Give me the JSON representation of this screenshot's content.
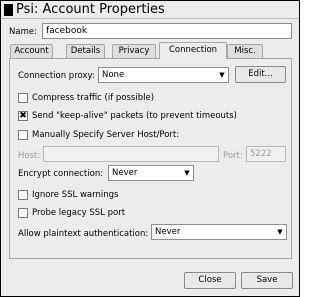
{
  "window": {
    "title": "Psi: Account Properties"
  },
  "name_field": {
    "label": "Name:",
    "value": "facebook"
  },
  "tabs": [
    {
      "label": "Account"
    },
    {
      "label": "Details"
    },
    {
      "label": "Privacy"
    },
    {
      "label": "Connection"
    },
    {
      "label": "Misc."
    }
  ],
  "active_tab": "Connection",
  "connection": {
    "proxy_label": "Connection proxy:",
    "proxy_value": "None",
    "edit_button": "Edit...",
    "compress_label": "Compress traffic (if possible)",
    "compress_checked": false,
    "keepalive_label": "Send \"keep-alive\" packets (to prevent timeouts)",
    "keepalive_checked": true,
    "manual_host_label": "Manually Specify Server Host/Port:",
    "manual_host_checked": false,
    "host_label": "Host:",
    "host_value": "",
    "port_label": "Port:",
    "port_value": "5222",
    "encrypt_label": "Encrypt connection:",
    "encrypt_value": "Never",
    "ignore_ssl_label": "Ignore SSL warnings",
    "ignore_ssl_checked": false,
    "legacy_ssl_label": "Probe legacy SSL port",
    "legacy_ssl_checked": false,
    "plaintext_label": "Allow plaintext authentication:",
    "plaintext_value": "Never"
  },
  "footer": {
    "close_button": "Close",
    "save_button": "Save"
  }
}
